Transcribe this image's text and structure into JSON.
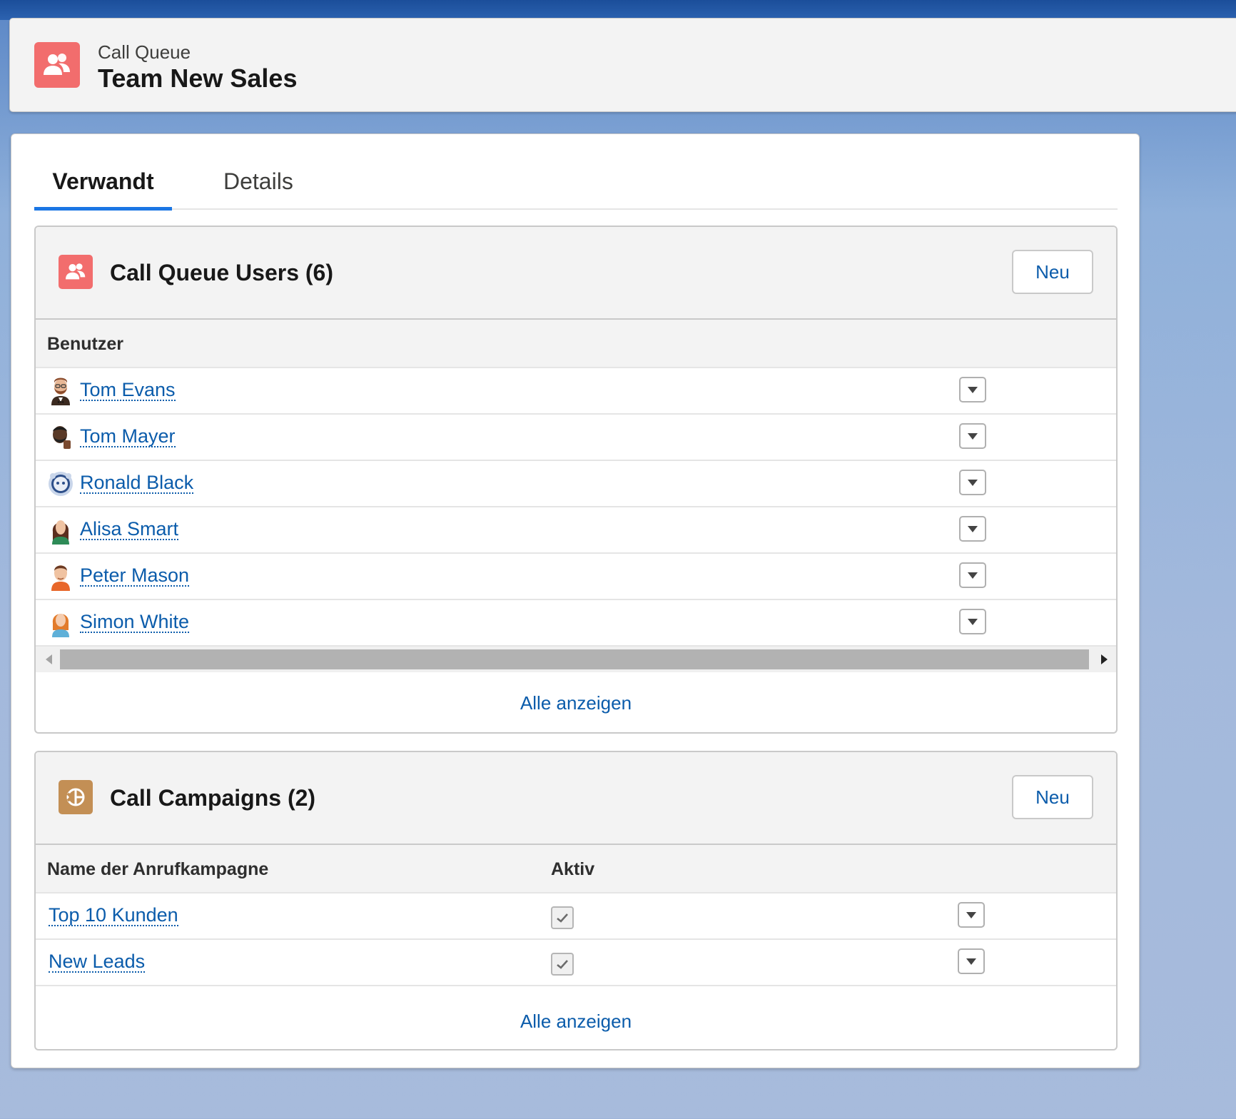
{
  "header": {
    "object_type": "Call Queue",
    "record_name": "Team New Sales",
    "icon": "call-queue-icon"
  },
  "tabs": [
    {
      "label": "Verwandt",
      "active": true
    },
    {
      "label": "Details",
      "active": false
    }
  ],
  "users_list": {
    "title": "Call Queue Users (6)",
    "icon": "call-queue-users-icon",
    "new_label": "Neu",
    "column": "Benutzer",
    "rows": [
      {
        "name": "Tom Evans",
        "avatar": "bearded-man-avatar"
      },
      {
        "name": "Tom Mayer",
        "avatar": "dark-skin-man-avatar"
      },
      {
        "name": "Ronald Black",
        "avatar": "astro-avatar"
      },
      {
        "name": "Alisa Smart",
        "avatar": "woman-avatar"
      },
      {
        "name": "Peter Mason",
        "avatar": "man-orange-shirt-avatar"
      },
      {
        "name": "Simon White",
        "avatar": "red-hair-avatar"
      }
    ],
    "view_all": "Alle anzeigen"
  },
  "campaigns_list": {
    "title": "Call Campaigns (2)",
    "icon": "call-campaign-icon",
    "new_label": "Neu",
    "columns": [
      "Name der Anrufkampagne",
      "Aktiv"
    ],
    "rows": [
      {
        "name": "Top 10 Kunden",
        "active": true
      },
      {
        "name": "New Leads",
        "active": true
      }
    ],
    "view_all": "Alle anzeigen"
  },
  "colors": {
    "accent": "#1b76e4",
    "link": "#0b5cab",
    "queue_icon": "#f26d6d",
    "campaign_icon": "#c38f55"
  }
}
